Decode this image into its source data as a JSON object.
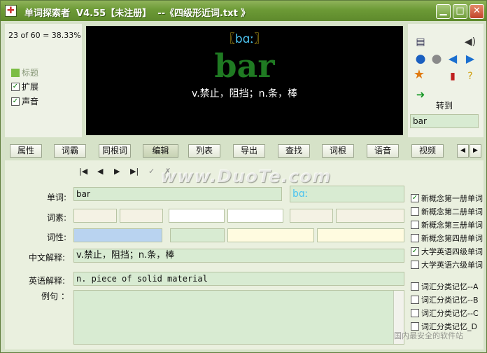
{
  "window": {
    "title": "单词探索者  V4.55【未注册】  --《四级形近词.txt 》",
    "min": "▁",
    "max": "□",
    "close": "✕"
  },
  "stats": "23 of 60 = 38.33%",
  "toggles": [
    {
      "label": "标题",
      "checked": false,
      "muted": true
    },
    {
      "label": "扩展",
      "checked": true
    },
    {
      "label": "声音",
      "checked": true
    }
  ],
  "display": {
    "bracket_open": "〖",
    "phonetic": "bɑː",
    "bracket_close": "〗",
    "word": "bar",
    "meaning": "v.禁止，阻挡；n.条，棒"
  },
  "goto": {
    "label": "转到",
    "value": "bar"
  },
  "tabs": [
    "属性",
    "词霸",
    "同根词",
    "编辑",
    "列表",
    "导出",
    "查找",
    "词根",
    "语音",
    "视频"
  ],
  "nav": {
    "first": "|◀",
    "prev": "◀",
    "next": "▶",
    "last": "▶|",
    "check": "✓",
    "cross": "✗"
  },
  "form": {
    "word_label": "单词:",
    "word": "bar",
    "phonetic": "bɑː",
    "morph_label": "词素:",
    "pos_label": "词性:",
    "cn_label": "中文解释:",
    "cn": "v.禁止，阻挡；n.条，棒",
    "en_label": "英语解释:",
    "en": "n.  piece of solid material",
    "ex_label": "例句 ："
  },
  "books": [
    {
      "label": "新概念第一册单词",
      "checked": true
    },
    {
      "label": "新概念第二册单词",
      "checked": false
    },
    {
      "label": "新概念第三册单词",
      "checked": false
    },
    {
      "label": "新概念第四册单词",
      "checked": false
    },
    {
      "label": "大学英语四级单词",
      "checked": true
    },
    {
      "label": "大学英语六级单词",
      "checked": false
    },
    {
      "label": "词汇分类记忆--A",
      "checked": false
    },
    {
      "label": "词汇分类记忆--B",
      "checked": false
    },
    {
      "label": "词汇分类记忆--C",
      "checked": false
    },
    {
      "label": "词汇分类记忆_D",
      "checked": false
    }
  ],
  "watermark": "www.DuoTe.com",
  "watermark2": "国内最安全的软件站"
}
